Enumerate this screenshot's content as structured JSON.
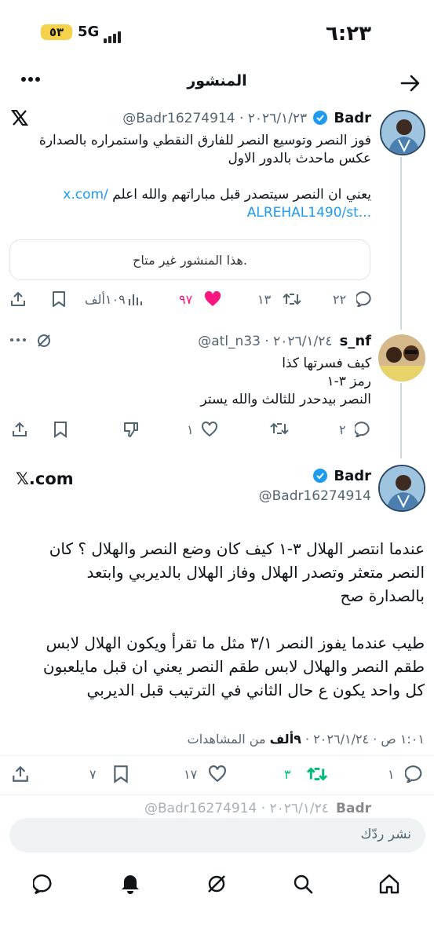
{
  "status": {
    "time": "٦:٢٣",
    "battery": "٥٣",
    "network": "5G"
  },
  "header": {
    "title": "المنشور"
  },
  "tweet1": {
    "name": "Badr",
    "handle_date": "@Badr16274914 · ٢٠٢٦/١/٢٣",
    "line1": "فوز النصر وتوسيع النصر للفارق النقطي واستمراره بالصدارة",
    "line2": "عكس ماحدث بالدور الاول",
    "line3_text": "يعني ان النصر سيتصدر قبل مباراتهم والله اعلم",
    "line3_link": "x.com/",
    "line4_link": "ALREHAL1490/st...",
    "card": "هذا المنشور غير متاح.",
    "replies": "٢٢",
    "reposts": "١٣",
    "likes": "٩٧",
    "views": "١٠٩ألف"
  },
  "tweet2": {
    "name": "s_nf",
    "handle_date": "@atl_n33 · ٢٠٢٦/١/٢٤",
    "line1": "كيف فسرتها كذا",
    "line2": "رمز ٣-١",
    "line3": "النصر بيدحدر للثالث والله يستر",
    "replies": "٢",
    "likes": "١"
  },
  "main": {
    "name": "Badr",
    "handle": "@Badr16274914",
    "source": "𝕏.com",
    "p1_l1": "عندما انتصر الهلال ٣-١ كيف كان وضع النصر والهلال ؟ كان",
    "p1_l2": "النصر متعثر وتصدر الهلال وفاز الهلال بالديربي وابتعد",
    "p1_l3": "بالصدارة صح",
    "p2_l1": "طيب عندما يفوز النصر ٣/١ مثل ما تقرأ ويكون الهلال لابس",
    "p2_l2": "طقم النصر والهلال لابس طقم النصر يعني ان قبل مايلعبون",
    "p2_l3": "كل واحد يكون ع حال الثاني في الترتيب قبل الديربي",
    "timestamp": "١:٠١ ص · ٢٠٢٦/١/٢٤ ·",
    "views_num": "٩ألف",
    "views_label": "من المشاهدات",
    "replies": "١",
    "reposts": "٣",
    "likes": "١٧",
    "bookmarks": "٧"
  },
  "partial": {
    "text": "@Badr16274914 · ٢٠٢٦/١/٢٤",
    "name": "Badr"
  },
  "reply": {
    "placeholder": "نشر ردّك"
  },
  "colors": {
    "accent": "#1d9bf0",
    "like": "#f91880",
    "repost": "#00ba7c"
  }
}
